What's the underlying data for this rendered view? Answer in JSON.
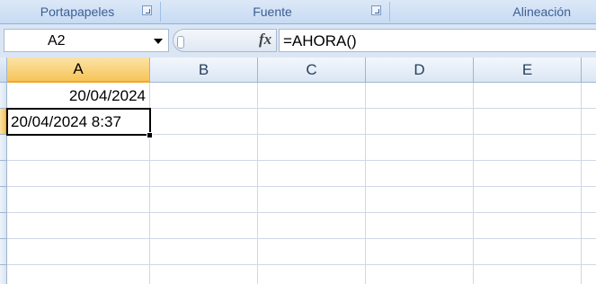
{
  "ribbon": {
    "groups": [
      {
        "label": "Portapapeles"
      },
      {
        "label": "Fuente"
      },
      {
        "label": "Alineación"
      }
    ]
  },
  "formula_bar": {
    "name_box": "A2",
    "fx_label": "fx",
    "formula": "=AHORA()"
  },
  "grid": {
    "columns": [
      "A",
      "B",
      "C",
      "D",
      "E"
    ],
    "selected_column": "A",
    "selected_row": 2,
    "cells": {
      "A1": "20/04/2024",
      "A2": "20/04/2024 8:37"
    }
  }
}
